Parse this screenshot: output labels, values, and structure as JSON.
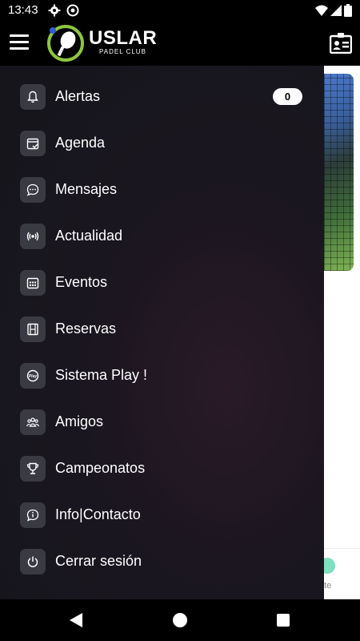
{
  "status_bar": {
    "time": "13:43",
    "icons": [
      "gear-icon",
      "at-sign-icon",
      "wifi-icon",
      "signal-icon",
      "battery-icon"
    ]
  },
  "header": {
    "logo_title": "USLAR",
    "logo_subtitle": "PADEL CLUB",
    "brand_color": "#8dc63f",
    "accent_color": "#2f5fd0",
    "menu_icon": "hamburger-menu-icon",
    "profile_icon": "id-card-icon"
  },
  "drawer": {
    "items": [
      {
        "label": "Alertas",
        "icon": "bell-icon",
        "badge": "0"
      },
      {
        "label": "Agenda",
        "icon": "calendar-check-icon"
      },
      {
        "label": "Mensajes",
        "icon": "chat-bubble-icon"
      },
      {
        "label": "Actualidad",
        "icon": "broadcast-icon"
      },
      {
        "label": "Eventos",
        "icon": "calendar-grid-icon"
      },
      {
        "label": "Reservas",
        "icon": "film-strip-icon"
      },
      {
        "label": "Sistema Play !",
        "icon": "play-badge-icon"
      },
      {
        "label": "Amigos",
        "icon": "group-icon"
      },
      {
        "label": "Campeonatos",
        "icon": "trophy-icon"
      },
      {
        "label": "Info|Contacto",
        "icon": "info-chat-icon"
      },
      {
        "label": "Cerrar sesión",
        "icon": "power-icon"
      }
    ]
  },
  "background_page": {
    "bottom_nav_label": "nte"
  },
  "nav_bar": {
    "icons": [
      "back-icon",
      "home-icon",
      "recents-icon"
    ]
  }
}
